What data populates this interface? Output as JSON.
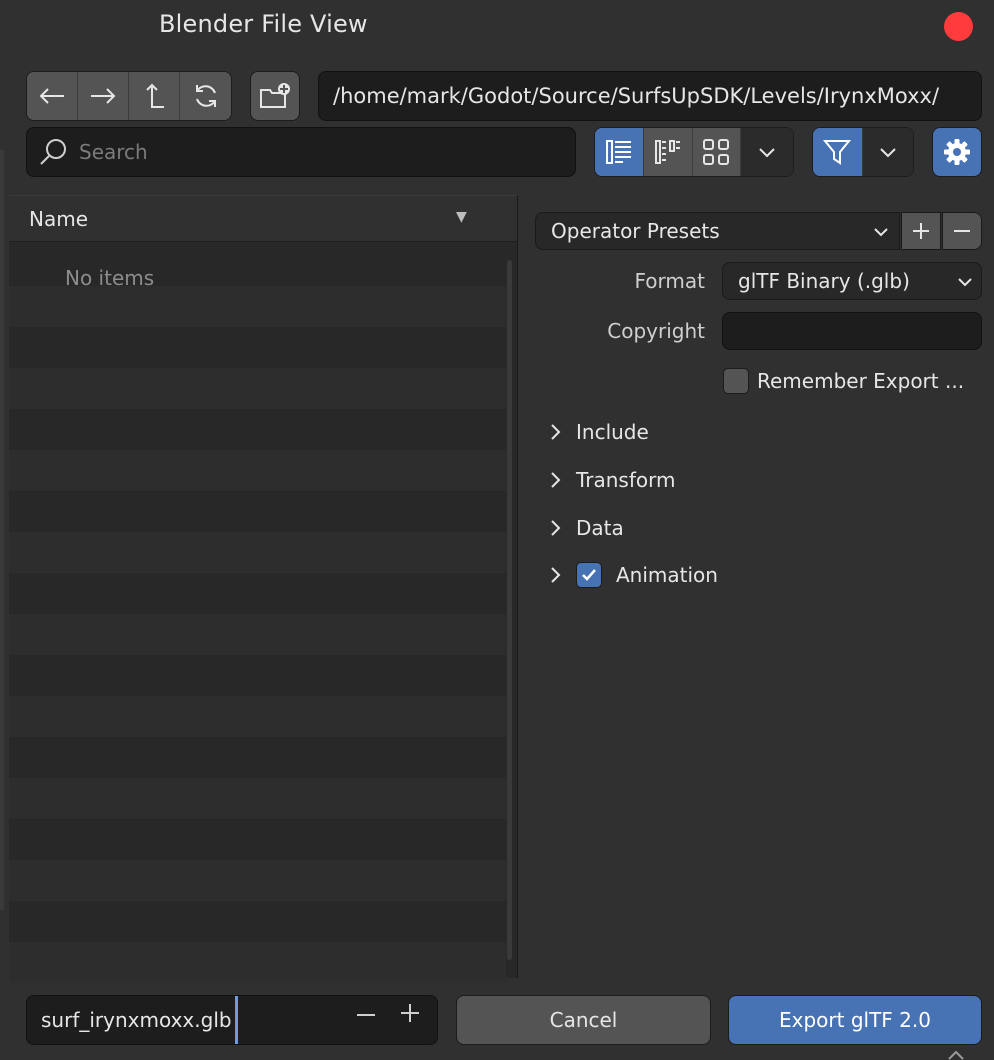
{
  "window": {
    "title": "Blender File View",
    "close_color": "#ff3b3b"
  },
  "toolbar": {
    "nav_icons": [
      "back-arrow-icon",
      "forward-arrow-icon",
      "parent-directory-icon",
      "refresh-icon"
    ],
    "new_folder_icon": "new-folder-icon",
    "path": "/home/mark/Godot/Source/SurfsUpSDK/Levels/IrynxMoxx/",
    "search_placeholder": "Search",
    "view_modes": [
      "vertical-list-icon",
      "horizontal-list-icon",
      "thumbnails-icon"
    ],
    "active_view_mode": "vertical-list-icon",
    "filter_active": true
  },
  "file_list": {
    "column_header": "Name",
    "empty_text": "No items"
  },
  "options": {
    "presets_label": "Operator Presets",
    "format_label": "Format",
    "format_value": "glTF Binary (.glb)",
    "copyright_label": "Copyright",
    "copyright_value": "",
    "remember_label": "Remember Export ...",
    "remember_checked": false,
    "sections": {
      "include": "Include",
      "transform": "Transform",
      "data": "Data",
      "animation": "Animation"
    },
    "animation_checked": true
  },
  "footer": {
    "filename": "surf_irynxmoxx.glb",
    "cancel_label": "Cancel",
    "export_label": "Export glTF 2.0"
  },
  "colors": {
    "accent": "#4772b3",
    "background": "#303030",
    "field": "#1d1d1d"
  }
}
